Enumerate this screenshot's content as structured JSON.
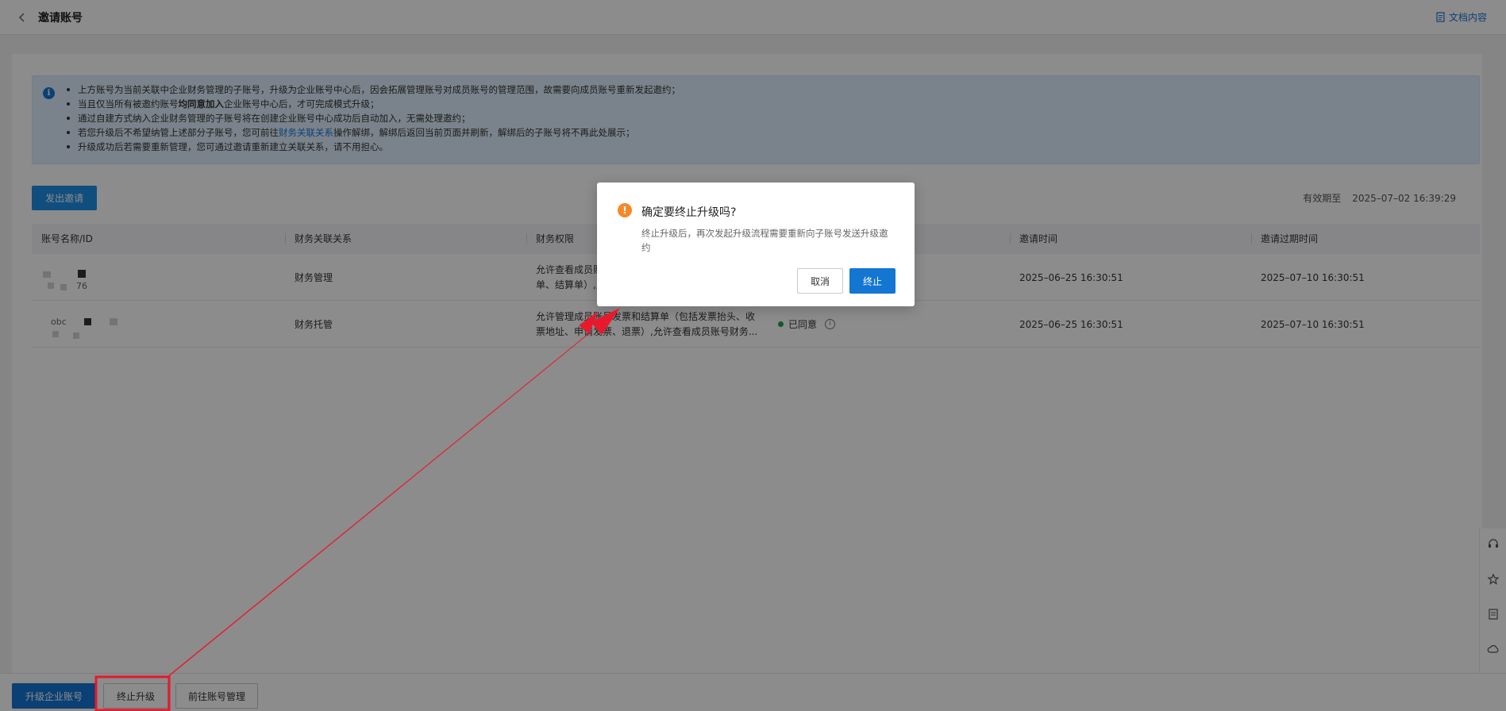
{
  "header": {
    "title": "邀请账号",
    "doc_link": "文档内容"
  },
  "notice": {
    "items": [
      {
        "before": "上方账号为当前关联中企业财务管理的子账号，升级为企业账号中心后，因会拓展管理账号对成员账号的管理范围，故需要向成员账号重新发起邀约；"
      },
      {
        "before": "当且仅当所有被邀约账号",
        "bold": "均同意加入",
        "after": "企业账号中心后，才可完成模式升级；"
      },
      {
        "before": "通过自建方式纳入企业财务管理的子账号将在创建企业账号中心成功后自动加入，无需处理邀约；"
      },
      {
        "before": "若您升级后不希望纳管上述部分子账号，您可前往",
        "link": "财务关联关系",
        "after": "操作解绑，解绑后返回当前页面并刷新，解绑后的子账号将不再此处展示；"
      },
      {
        "before": "升级成功后若需要重新管理，您可通过邀请重新建立关联关系，请不用担心。"
      }
    ]
  },
  "toolbar": {
    "invite_button": "发出邀请",
    "valid_label": "有效期至",
    "valid_value": "2025–07–02 16:39:29"
  },
  "table": {
    "columns": [
      "账号名称/ID",
      "财务关联关系",
      "财务权限",
      "",
      "邀请时间",
      "邀请过期时间"
    ],
    "rows": [
      {
        "account_fragment": "76",
        "relation": "财务管理",
        "perm_line1": "允许查看成员账号",
        "perm_line2": "单、结算单）,允许",
        "status": "",
        "invite_time": "2025–06–25 16:30:51",
        "expire_time": "2025–07–10 16:30:51"
      },
      {
        "account_fragment": "obc",
        "relation": "财务托管",
        "perm_line1": "允许管理成员账号发票和结算单（包括发票抬头、收",
        "perm_line2": "票地址、申请发票、退票）,允许查看成员账号财务...",
        "status": "已同意",
        "invite_time": "2025–06–25 16:30:51",
        "expire_time": "2025–07–10 16:30:51"
      }
    ]
  },
  "footer": {
    "upgrade_button": "升级企业账号",
    "terminate_button": "终止升级",
    "goto_button": "前往账号管理"
  },
  "dialog": {
    "title": "确定要终止升级吗?",
    "body": "终止升级后，再次发起升级流程需要重新向子账号发送升级邀约",
    "cancel": "取消",
    "confirm": "终止"
  },
  "colors": {
    "primary": "#1476d3",
    "warning": "#f5892a",
    "annotation": "#e8192c",
    "success": "#24a148"
  },
  "icons": [
    "back-icon",
    "doc-icon",
    "info-icon",
    "warning-icon",
    "headset-icon",
    "star-icon",
    "document-icon",
    "cloud-icon",
    "chevron-right-icon"
  ]
}
